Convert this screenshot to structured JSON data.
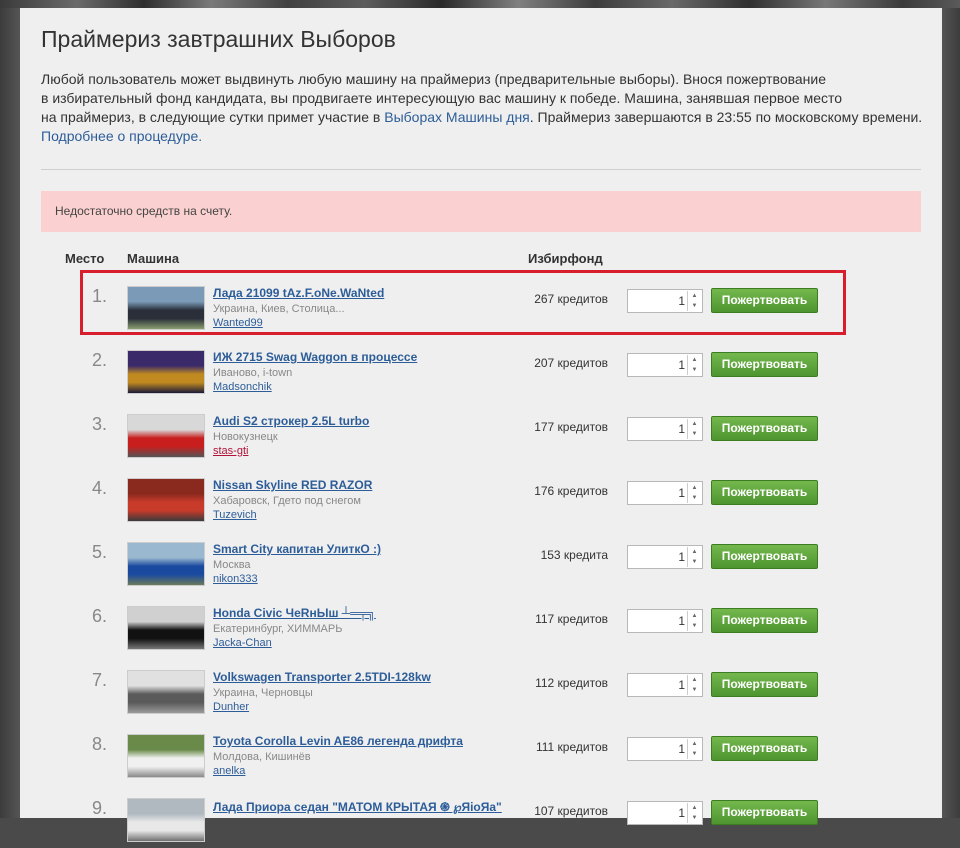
{
  "page": {
    "title": "Праймериз завтрашних Выборов",
    "intro_line1": "Любой пользователь может выдвинуть любую машину на праймериз (предварительные выборы). Внося пожертвование",
    "intro_line2": "в избирательный фонд кандидата, вы продвигаете интересующую вас машину к победе. Машина, занявшая первое место",
    "intro_line3_before": "на праймериз, в следующие сутки примет участие в ",
    "intro_link_elections": "Выборах Машины дня",
    "intro_line3_after": ". Праймериз завершаются в 23:55 по московскому времени.",
    "intro_link_more": "Подробнее о процедуре."
  },
  "alert": {
    "text": "Недостаточно средств на счету."
  },
  "table": {
    "headers": {
      "place": "Место",
      "car": "Машина",
      "fund": "Избирфонд"
    },
    "rows": [
      {
        "place": "1.",
        "name": "Лада 21099 tAz.F.oNe.WaNted",
        "location": "Украина, Киев, Столица...",
        "user": "Wanted99",
        "credits": "267 кредитов",
        "qty": "1",
        "button": "Пожертвовать",
        "thumb_colors": [
          "#7a9ab8",
          "#2a2f3a",
          "#8aa070"
        ]
      },
      {
        "place": "2.",
        "name": "ИЖ 2715 Swag Waggon в процессе",
        "location": "Иваново, i-town",
        "user": "Madsonchik",
        "credits": "207 кредитов",
        "qty": "1",
        "button": "Пожертвовать",
        "thumb_colors": [
          "#3a2a6a",
          "#c08a20",
          "#1a1a3a"
        ]
      },
      {
        "place": "3.",
        "name": "Audi S2 строкер 2.5L turbo",
        "location": "Новокузнецк",
        "user": "stas-gti",
        "credits": "177 кредитов",
        "qty": "1",
        "button": "Пожертвовать",
        "thumb_colors": [
          "#d8d8d8",
          "#c81e1e",
          "#555555"
        ]
      },
      {
        "place": "4.",
        "name": "Nissan Skyline RED RAZOR",
        "location": "Хабаровск, Гдето под снегом",
        "user": "Tuzevich",
        "credits": "176 кредитов",
        "qty": "1",
        "button": "Пожертвовать",
        "thumb_colors": [
          "#8a2a1e",
          "#c83a2a",
          "#3a3a3a"
        ]
      },
      {
        "place": "5.",
        "name": "Smart City капитан УлиткО :)",
        "location": "Москва",
        "user": "nikon333",
        "credits": "153 кредита",
        "qty": "1",
        "button": "Пожертвовать",
        "thumb_colors": [
          "#9ab8d0",
          "#1a4aa0",
          "#6a7a5a"
        ]
      },
      {
        "place": "6.",
        "name": "Honda Civic ЧеRнЫш ┴═╤╗",
        "location": "Екатеринбург, ХИММАРЬ",
        "user": "Jacka-Chan",
        "credits": "117 кредитов",
        "qty": "1",
        "button": "Пожертвовать",
        "thumb_colors": [
          "#d0d0d0",
          "#111111",
          "#777777"
        ]
      },
      {
        "place": "7.",
        "name": "Volkswagen Transporter 2.5TDI-128kw",
        "location": "Украина, Черновцы",
        "user": "Dunher",
        "credits": "112 кредитов",
        "qty": "1",
        "button": "Пожертвовать",
        "thumb_colors": [
          "#e0e0e0",
          "#5a5a5a",
          "#9a9a9a"
        ]
      },
      {
        "place": "8.",
        "name": "Toyota Corolla Levin AE86 легенда дрифта",
        "location": "Молдова, Кишинёв",
        "user": "anelka",
        "credits": "111 кредитов",
        "qty": "1",
        "button": "Пожертвовать",
        "thumb_colors": [
          "#6a8a4a",
          "#f0f0f0",
          "#8a8a8a"
        ]
      },
      {
        "place": "9.",
        "name": "Лада Приора седан \"МАТОМ КРЫТАЯ ֍ ℘ЯioЯa\"",
        "location": "",
        "user": "",
        "credits": "107 кредитов",
        "qty": "1",
        "button": "Пожертвовать",
        "thumb_colors": [
          "#b0b8c0",
          "#e8e8e8",
          "#707070"
        ]
      }
    ]
  }
}
